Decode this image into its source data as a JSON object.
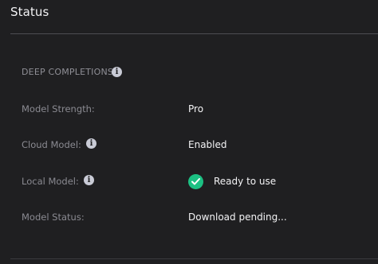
{
  "panel": {
    "title": "Status",
    "section_label": "DEEP COMPLETIONS",
    "rows": [
      {
        "label": "Model Strength:",
        "value": "Pro"
      },
      {
        "label": "Cloud Model:",
        "value": "Enabled"
      },
      {
        "label": "Local Model:",
        "value": "Ready to use"
      },
      {
        "label": "Model Status:",
        "value": "Download pending..."
      }
    ]
  },
  "icons": {
    "info": "info-icon",
    "check": "check-circle-icon"
  },
  "colors": {
    "background": "#1f1f21",
    "success": "#1cc083"
  }
}
